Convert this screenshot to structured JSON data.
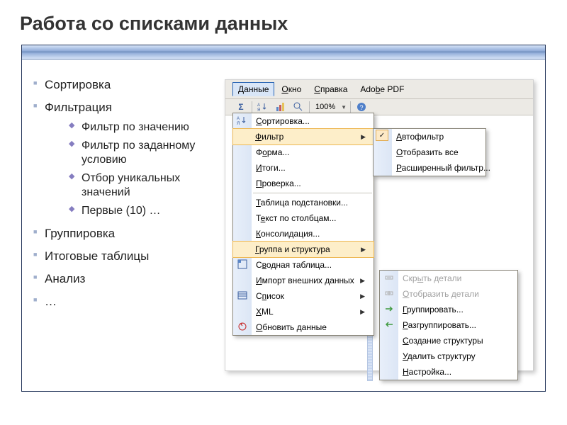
{
  "title": "Работа со списками данных",
  "bullets": [
    {
      "label": "Сортировка"
    },
    {
      "label": "Фильтрация",
      "sub": [
        "Фильтр по значению",
        "Фильтр по заданному условию",
        "Отбор уникальных значений",
        "Первые (10) …"
      ]
    },
    {
      "label": "Группировка"
    },
    {
      "label": "Итоговые таблицы"
    },
    {
      "label": "Анализ"
    },
    {
      "label": "…"
    }
  ],
  "excel": {
    "menubar": [
      "Данные",
      "Окно",
      "Справка",
      "Adobe PDF"
    ],
    "menubar_ul": [
      "Д",
      "О",
      "С",
      ""
    ],
    "zoom": "100%",
    "data_menu": {
      "items": [
        {
          "label": "Сортировка...",
          "ul": "С",
          "icon": "sort-icon"
        },
        {
          "label": "Фильтр",
          "ul": "Ф",
          "arrow": true,
          "hl": true
        },
        {
          "label": "Форма...",
          "ul": "о"
        },
        {
          "label": "Итоги...",
          "ul": "И"
        },
        {
          "label": "Проверка...",
          "ul": "П"
        },
        {
          "sep": true
        },
        {
          "label": "Таблица подстановки...",
          "ul": "Т"
        },
        {
          "label": "Текст по столбцам...",
          "ul": "е"
        },
        {
          "label": "Консолидация...",
          "ul": "К"
        },
        {
          "label": "Группа и структура",
          "ul": "Г",
          "arrow": true,
          "hl": true
        },
        {
          "label": "Сводная таблица...",
          "ul": "в",
          "icon": "pivot-icon"
        },
        {
          "label": "Импорт внешних данных",
          "ul": "И",
          "arrow": true
        },
        {
          "label": "Список",
          "ul": "п",
          "arrow": true,
          "icon": "list-icon"
        },
        {
          "label": "XML",
          "ul": "X",
          "arrow": true
        },
        {
          "label": "Обновить данные",
          "ul": "О",
          "icon": "refresh-icon"
        }
      ]
    },
    "filter_submenu": [
      {
        "label": "Автофильтр",
        "ul": "А",
        "checked": true
      },
      {
        "label": "Отобразить все",
        "ul": "О"
      },
      {
        "label": "Расширенный фильтр...",
        "ul": "Р"
      }
    ],
    "group_submenu": [
      {
        "label": "Скрыть детали",
        "ul": "ы",
        "gray": true,
        "icon": "hide-detail-icon"
      },
      {
        "label": "Отобразить детали",
        "ul": "О",
        "gray": true,
        "icon": "show-detail-icon"
      },
      {
        "label": "Группировать...",
        "ul": "Г",
        "icon": "group-icon"
      },
      {
        "label": "Разгруппировать...",
        "ul": "Р",
        "icon": "ungroup-icon"
      },
      {
        "label": "Создание структуры",
        "ul": "С"
      },
      {
        "label": "Удалить структуру",
        "ul": "У"
      },
      {
        "label": "Настройка...",
        "ul": "Н"
      }
    ]
  }
}
